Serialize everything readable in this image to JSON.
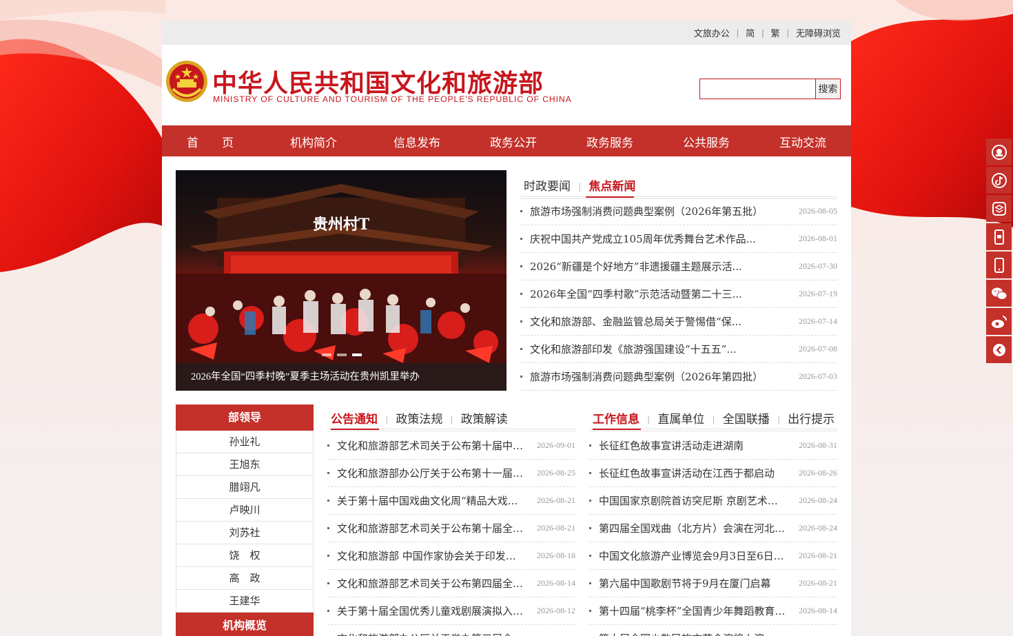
{
  "topbar": {
    "links": [
      "文旅办公",
      "简",
      "繁",
      "无障碍浏览"
    ]
  },
  "header": {
    "title": "中华人民共和国文化和旅游部",
    "subtitle": "MINISTRY OF CULTURE AND TOURISM OF THE PEOPLE'S REPUBLIC OF CHINA",
    "search_button": "搜索",
    "search_value": ""
  },
  "nav": {
    "items": [
      "首　　页",
      "机构简介",
      "信息发布",
      "政务公开",
      "政务服务",
      "公共服务",
      "互动交流"
    ]
  },
  "banner": {
    "sign_text": "贵州村T",
    "caption": "2026年全国“四季村晚”夏季主场活动在贵州凯里举办",
    "active_dot": 2
  },
  "news": {
    "tabs": [
      "时政要闻",
      "焦点新闻"
    ],
    "active_tab": 1,
    "items": [
      {
        "title": "旅游市场强制消费问题典型案例（2026年第五批）",
        "date": "2026-08-05"
      },
      {
        "title": "庆祝中国共产党成立105周年优秀舞台艺术作品...",
        "date": "2026-08-01"
      },
      {
        "title": "2026“新疆是个好地方”非遗援疆主题展示活...",
        "date": "2026-07-30"
      },
      {
        "title": "2026年全国“四季村歌”示范活动暨第二十三...",
        "date": "2026-07-19"
      },
      {
        "title": "文化和旅游部、金融监管总局关于警惕借“保...",
        "date": "2026-07-14"
      },
      {
        "title": "文化和旅游部印发《旅游强国建设“十五五”...",
        "date": "2026-07-08"
      },
      {
        "title": "旅游市场强制消费问题典型案例（2026年第四批）",
        "date": "2026-07-03"
      }
    ]
  },
  "leaders": {
    "heading": "部领导",
    "names": [
      "孙业礼",
      "王旭东",
      "腊翊凡",
      "卢映川",
      "刘苏社",
      "饶　权",
      "高　政",
      "王建华"
    ],
    "heading2": "机构概览"
  },
  "notices": {
    "tabs": [
      "公告通知",
      "政策法规",
      "政策解读"
    ],
    "active_tab": 0,
    "items": [
      {
        "title": "文化和旅游部艺术司关于公布第十届中国戏曲文化周",
        "date": "2026-09-01"
      },
      {
        "title": "文化和旅游部办公厅关于公布第十一届全国非遗",
        "date": "2026-08-25"
      },
      {
        "title": "关于第十届中国戏曲文化周“精品大戏展演”",
        "date": "2026-08-21"
      },
      {
        "title": "文化和旅游部艺术司关于公布第十届全国戏剧",
        "date": "2026-08-21"
      },
      {
        "title": "文化和旅游部 中国作家协会关于印发文件",
        "date": "2026-08-18"
      },
      {
        "title": "文化和旅游部艺术司关于公布第四届全国优秀",
        "date": "2026-08-14"
      },
      {
        "title": "关于第十届全国优秀儿童戏剧展演拟入选剧目",
        "date": "2026-08-12"
      },
      {
        "title": "文化和旅游部办公厅关于举办第三届全",
        "date": ""
      }
    ]
  },
  "work": {
    "tabs": [
      "工作信息",
      "直属单位",
      "全国联播",
      "出行提示"
    ],
    "active_tab": 0,
    "items": [
      {
        "title": "长征红色故事宣讲活动走进湖南",
        "date": "2026-08-31"
      },
      {
        "title": "长征红色故事宣讲活动在江西于都启动",
        "date": "2026-08-26"
      },
      {
        "title": "中国国家京剧院首访突尼斯 京剧艺术绽放",
        "date": "2026-08-24"
      },
      {
        "title": "第四届全国戏曲（北方片）会演在河北石家庄",
        "date": "2026-08-24"
      },
      {
        "title": "中国文化旅游产业博览会9月3日至6日举办",
        "date": "2026-08-21"
      },
      {
        "title": "第六届中国歌剧节将于9月在厦门启幕",
        "date": "2026-08-21"
      },
      {
        "title": "第十四届“桃李杯”全国青少年舞蹈教育成果展",
        "date": "2026-08-14"
      },
      {
        "title": "第十届全国少数民族文艺会演将上演",
        "date": ""
      }
    ]
  },
  "side_tools": [
    "emblem-icon",
    "douyin-icon",
    "app-icon",
    "mobile-service-icon",
    "phone-icon",
    "wechat-icon",
    "weibo-icon",
    "back-icon"
  ],
  "colors": {
    "brand_red": "#c8161d",
    "nav_red": "#c4302a"
  }
}
